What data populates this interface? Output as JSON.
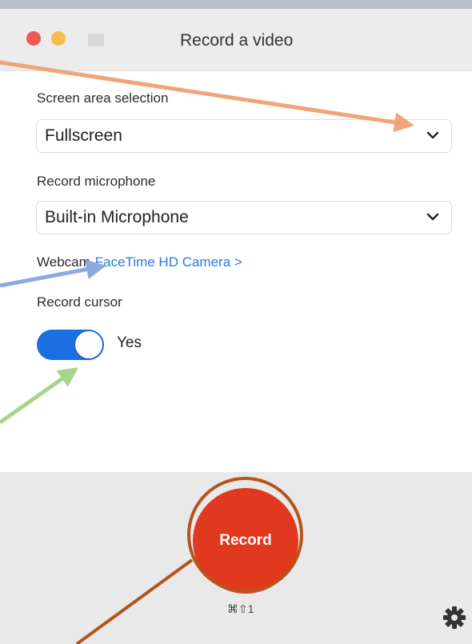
{
  "window": {
    "title": "Record a video"
  },
  "screen_area": {
    "label": "Screen area selection",
    "value": "Fullscreen"
  },
  "microphone": {
    "label": "Record microphone",
    "value": "Built-in Microphone"
  },
  "webcam": {
    "label": "Webcam",
    "link": "FaceTime HD Camera >"
  },
  "cursor": {
    "label": "Record cursor",
    "toggle_on": true,
    "toggle_text": "Yes"
  },
  "record": {
    "label": "Record",
    "shortcut": "⌘⇧1"
  },
  "icons": [
    "chevron-down-icon",
    "gear-icon"
  ],
  "colors": {
    "record": "#e0391f",
    "toggle": "#1c6fe0",
    "link": "#2a7ad9",
    "arrow_orange": "#f0a47a",
    "arrow_blue": "#8ea8e0",
    "arrow_green": "#a8d48c",
    "circle_brown": "#b5531f"
  }
}
